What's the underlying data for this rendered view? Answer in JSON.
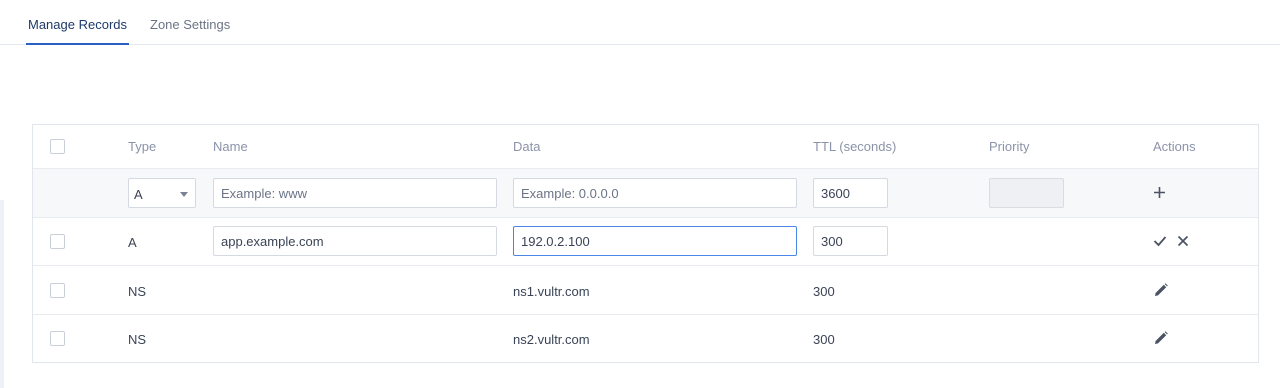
{
  "tabs": [
    {
      "label": "Manage Records",
      "active": true
    },
    {
      "label": "Zone Settings",
      "active": false
    }
  ],
  "table": {
    "columns": [
      "Type",
      "Name",
      "Data",
      "TTL (seconds)",
      "Priority",
      "Actions"
    ],
    "add_row": {
      "type_value": "A",
      "name_placeholder": "Example: www",
      "data_placeholder": "Example: 0.0.0.0",
      "ttl_value": "3600",
      "priority_value": "",
      "action_icon": "plus-icon"
    },
    "edit_row": {
      "type": "A",
      "name_value": "app.example.com",
      "data_value": "192.0.2.100",
      "ttl_value": "300",
      "action_icons": [
        "check-icon",
        "close-icon"
      ]
    },
    "records": [
      {
        "type": "NS",
        "name": "",
        "data": "ns1.vultr.com",
        "ttl": "300",
        "priority": "",
        "action_icon": "pencil-icon"
      },
      {
        "type": "NS",
        "name": "",
        "data": "ns2.vultr.com",
        "ttl": "300",
        "priority": "",
        "action_icon": "pencil-icon"
      }
    ]
  },
  "colors": {
    "accent": "#2a5fc4",
    "focus_border": "#4a86e8",
    "header_text": "#8a93a8",
    "body_text": "#3a4356"
  }
}
